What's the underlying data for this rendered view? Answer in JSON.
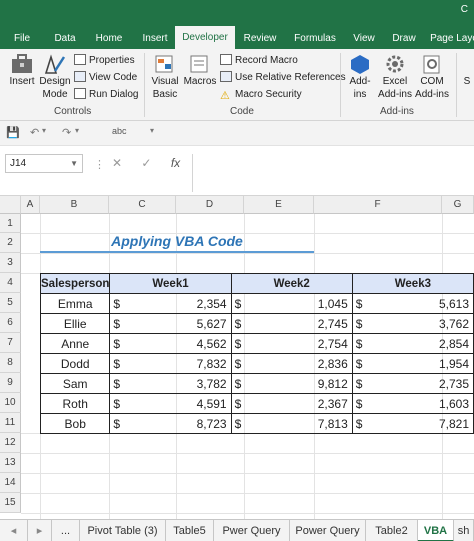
{
  "ribbon_tabs": [
    "File",
    "Data",
    "Home",
    "Insert",
    "Developer",
    "Review",
    "Formulas",
    "View",
    "Draw",
    "Page Layo"
  ],
  "active_tab": "Developer",
  "title_fragment": "C",
  "groups": {
    "controls": {
      "label": "Controls",
      "insert": "Insert",
      "design_mode_1": "Design",
      "design_mode_2": "Mode",
      "properties": "Properties",
      "view_code": "View Code",
      "run_dialog": "Run Dialog"
    },
    "code": {
      "label": "Code",
      "visual_basic_1": "Visual",
      "visual_basic_2": "Basic",
      "macros": "Macros",
      "record_macro": "Record Macro",
      "use_relative": "Use Relative References",
      "macro_security": "Macro Security"
    },
    "addins": {
      "label": "Add-ins",
      "addins_1": "Add-",
      "addins_2": "ins",
      "excel_addins_1": "Excel",
      "excel_addins_2": "Add-ins",
      "com_addins_1": "COM",
      "com_addins_2": "Add-ins"
    },
    "extra": "S"
  },
  "qat": {
    "format_label": "abc"
  },
  "name_box": "J14",
  "fx": "fx",
  "columns": [
    "A",
    "B",
    "C",
    "D",
    "E",
    "F",
    "G"
  ],
  "rows": [
    "1",
    "2",
    "3",
    "4",
    "5",
    "6",
    "7",
    "8",
    "9",
    "10",
    "11",
    "12",
    "13",
    "14",
    "15"
  ],
  "sheet_title": "Applying VBA Code",
  "table": {
    "headers": [
      "Salesperson",
      "Week1",
      "Week2",
      "Week3"
    ],
    "currency": "$",
    "rows": [
      {
        "name": "Emma",
        "w1": "2,354",
        "w2": "1,045",
        "w3": "5,613"
      },
      {
        "name": "Ellie",
        "w1": "5,627",
        "w2": "2,745",
        "w3": "3,762"
      },
      {
        "name": "Anne",
        "w1": "4,562",
        "w2": "2,754",
        "w3": "2,854"
      },
      {
        "name": "Dodd",
        "w1": "7,832",
        "w2": "2,836",
        "w3": "1,954"
      },
      {
        "name": "Sam",
        "w1": "3,782",
        "w2": "9,812",
        "w3": "2,735"
      },
      {
        "name": "Roth",
        "w1": "4,591",
        "w2": "2,367",
        "w3": "1,603"
      },
      {
        "name": "Bob",
        "w1": "8,723",
        "w2": "7,813",
        "w3": "7,821"
      }
    ]
  },
  "sheet_tabs": {
    "more": "...",
    "tabs": [
      "Pivot Table (3)",
      "Table5",
      "Pwer Query",
      "Power Query",
      "Table2",
      "VBA",
      "sh"
    ],
    "active": "VBA"
  },
  "colors": {
    "excel_green": "#217346",
    "title_blue": "#2e75b6",
    "header_fill": "#dbe5f8"
  }
}
